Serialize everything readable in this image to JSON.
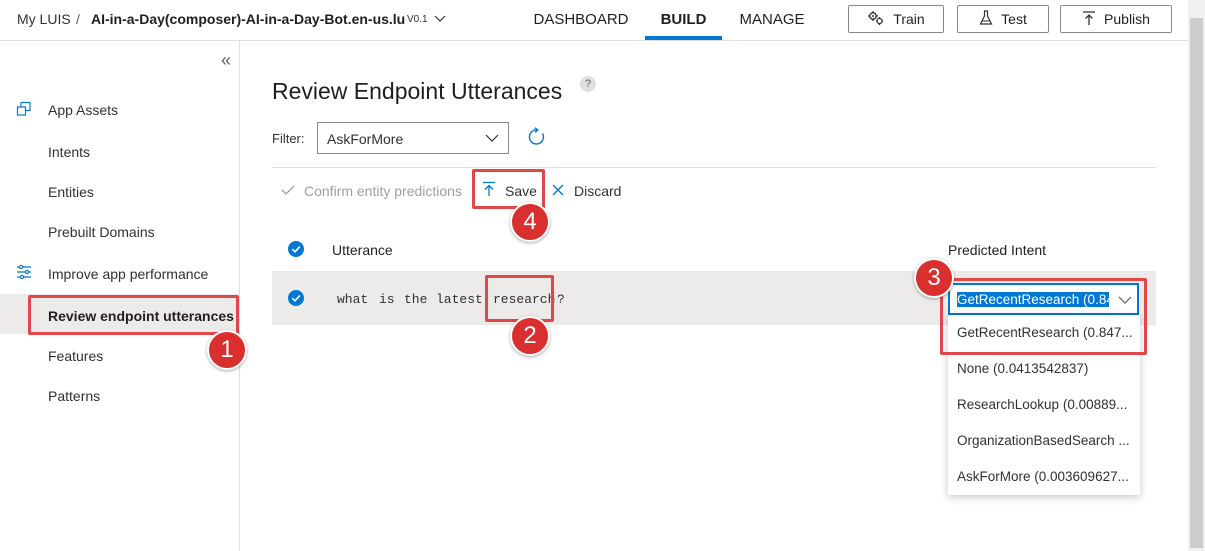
{
  "header": {
    "home": "My LUIS",
    "separator": "/",
    "app_name": "AI-in-a-Day(composer)-AI-in-a-Day-Bot.en-us.lu",
    "version": "V0.1",
    "tabs": [
      "DASHBOARD",
      "BUILD",
      "MANAGE"
    ],
    "active_tab": "BUILD",
    "buttons": {
      "train": "Train",
      "test": "Test",
      "publish": "Publish"
    }
  },
  "sidebar": {
    "collapse_glyph": "«",
    "sections": [
      {
        "label": "App Assets",
        "icon": "app-assets-icon"
      },
      {
        "label": "Improve app performance",
        "icon": "sliders-icon"
      }
    ],
    "items": [
      "Intents",
      "Entities",
      "Prebuilt Domains",
      "Review endpoint utterances",
      "Features",
      "Patterns"
    ],
    "selected": "Review endpoint utterances"
  },
  "main": {
    "title": "Review Endpoint Utterances",
    "help_glyph": "?",
    "filter_label": "Filter:",
    "filter_value": "AskForMore",
    "toolbar": {
      "confirm": "Confirm entity predictions",
      "save": "Save",
      "discard": "Discard"
    },
    "table": {
      "columns": [
        "Utterance",
        "Predicted Intent"
      ],
      "rows": [
        {
          "words": [
            "what",
            "is",
            "the",
            "latest",
            "research",
            "?"
          ],
          "intent": "GetRecentResearch (0.84"
        }
      ]
    },
    "dropdown_options": [
      "GetRecentResearch (0.847...",
      "None (0.0413542837)",
      "ResearchLookup (0.00889...",
      "OrganizationBasedSearch ...",
      "AskForMore (0.003609627..."
    ]
  },
  "callouts": [
    "1",
    "2",
    "3",
    "4"
  ],
  "colors": {
    "accent": "#0078d4",
    "callout": "#d9302f",
    "highlight": "#e04848",
    "selected_row": "#edebe9"
  }
}
